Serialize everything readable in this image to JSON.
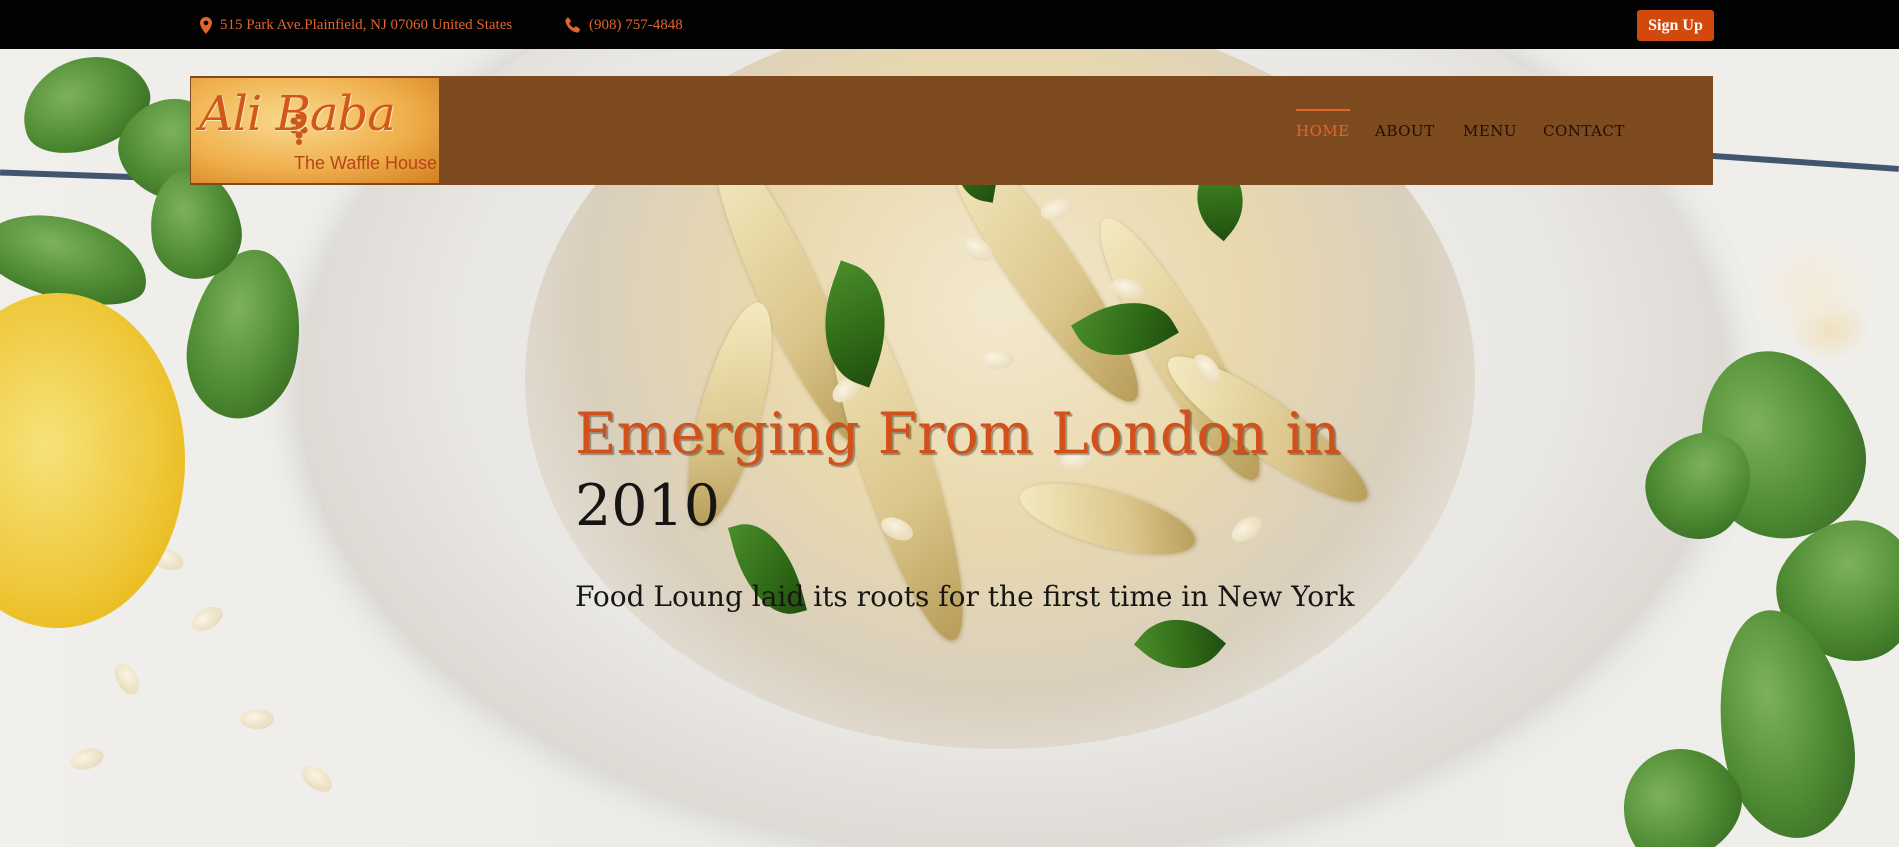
{
  "topbar": {
    "address": "515 Park Ave.Plainfield, NJ 07060 United States",
    "phone": "(908) 757-4848",
    "address_icon": "map-marker-icon",
    "phone_icon": "phone-icon",
    "signup_label": "Sign Up"
  },
  "header": {
    "logo": {
      "title": "Ali Baba",
      "subtitle": "The Waffle House"
    },
    "nav": [
      {
        "label": "HOME",
        "active": true
      },
      {
        "label": "ABOUT",
        "active": false
      },
      {
        "label": "MENU",
        "active": false
      },
      {
        "label": "CONTACT",
        "active": false
      }
    ]
  },
  "hero": {
    "headline_accent": "Emerging From London in",
    "headline_year": "2010",
    "subtitle": "Food Loung laid its roots for the first time in New York"
  },
  "colors": {
    "topbar_bg": "#020202",
    "accent": "#d2490d",
    "nav_bg": "#7e4a20",
    "text_dark": "#161513"
  }
}
